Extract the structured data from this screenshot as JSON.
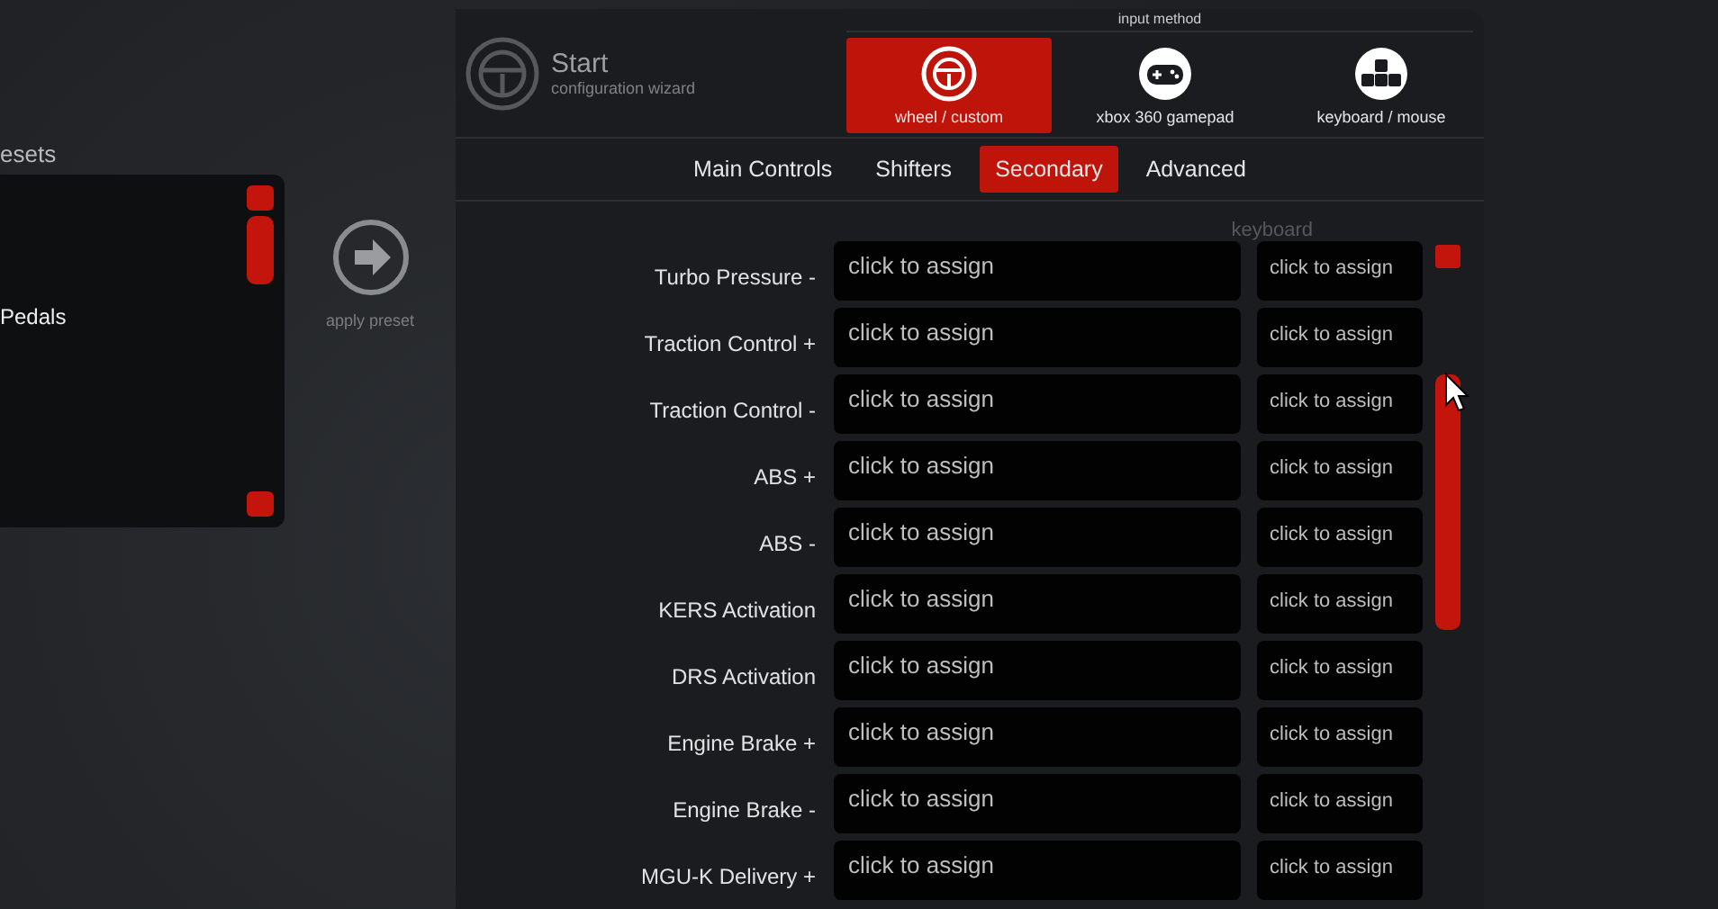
{
  "presets_panel": {
    "title": "esets",
    "items": [
      "Pedals"
    ],
    "apply_label": "apply preset"
  },
  "wizard": {
    "title": "Start",
    "subtitle": "configuration wizard"
  },
  "input_method": {
    "label": "input method",
    "options": [
      {
        "kind": "wheel",
        "label": "wheel / custom",
        "selected": true
      },
      {
        "kind": "gamepad",
        "label": "xbox 360 gamepad",
        "selected": false
      },
      {
        "kind": "keyboard",
        "label": "keyboard / mouse",
        "selected": false
      }
    ]
  },
  "tabs": [
    {
      "label": "Main Controls",
      "selected": false
    },
    {
      "label": "Shifters",
      "selected": false
    },
    {
      "label": "Secondary",
      "selected": true
    },
    {
      "label": "Advanced",
      "selected": false
    }
  ],
  "keyboard_header": "keyboard",
  "bindings": [
    {
      "label": "Turbo Pressure -",
      "primary": "click to assign",
      "keyboard": "click to assign"
    },
    {
      "label": "Traction Control +",
      "primary": "click to assign",
      "keyboard": "click to assign"
    },
    {
      "label": "Traction Control -",
      "primary": "click to assign",
      "keyboard": "click to assign"
    },
    {
      "label": "ABS +",
      "primary": "click to assign",
      "keyboard": "click to assign"
    },
    {
      "label": "ABS -",
      "primary": "click to assign",
      "keyboard": "click to assign"
    },
    {
      "label": "KERS Activation",
      "primary": "click to assign",
      "keyboard": "click to assign"
    },
    {
      "label": "DRS Activation",
      "primary": "click to assign",
      "keyboard": "click to assign"
    },
    {
      "label": "Engine Brake +",
      "primary": "click to assign",
      "keyboard": "click to assign"
    },
    {
      "label": "Engine Brake -",
      "primary": "click to assign",
      "keyboard": "click to assign"
    },
    {
      "label": "MGU-K Delivery +",
      "primary": "click to assign",
      "keyboard": "click to assign"
    }
  ]
}
